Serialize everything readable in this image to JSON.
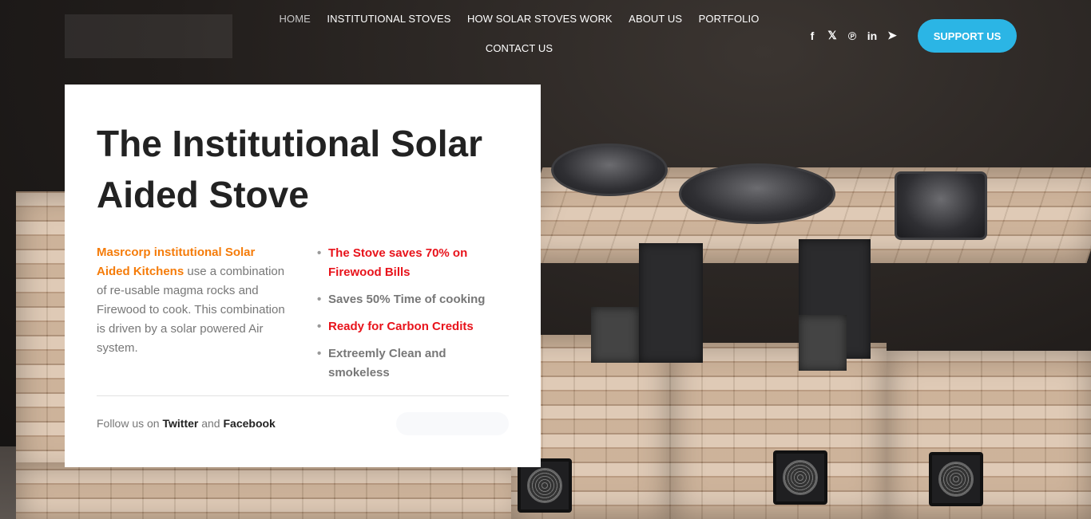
{
  "nav": {
    "items": [
      {
        "label": "HOME",
        "active": true
      },
      {
        "label": "INSTITUTIONAL STOVES"
      },
      {
        "label": "HOW SOLAR STOVES WORK"
      },
      {
        "label": "ABOUT US"
      },
      {
        "label": "PORTFOLIO"
      },
      {
        "label": "CONTACT US"
      }
    ]
  },
  "social": {
    "icons": [
      "facebook-icon",
      "x-icon",
      "pinterest-icon",
      "linkedin-icon",
      "telegram-icon"
    ],
    "glyphs": [
      "f",
      "𝕏",
      "℗",
      "in",
      "➤"
    ]
  },
  "support_button": {
    "label": "SUPPORT US",
    "color": "#2bb5e5"
  },
  "hero": {
    "title": "The Institutional Solar Aided Stove",
    "intro_highlight": "Masrcorp institutional Solar Aided Kitchens",
    "intro_text": " use a combination of re-usable magma rocks and Firewood to cook. This combination is driven by a solar powered Air system.",
    "bullets": [
      {
        "text": "The Stove saves 70% on Firewood Bills",
        "style": "red"
      },
      {
        "text": "Saves 50% Time of cooking",
        "style": "gray"
      },
      {
        "text": "Ready for Carbon Credits",
        "style": "red"
      },
      {
        "text": "Extreemly Clean and smokeless",
        "style": "gray"
      }
    ],
    "follow_prefix": "Follow us on ",
    "follow_twitter": "Twitter",
    "follow_and": " and ",
    "follow_facebook": "Facebook"
  },
  "colors": {
    "accent_orange": "#f57c0a",
    "accent_red": "#e8131b",
    "accent_blue": "#2bb5e5"
  }
}
